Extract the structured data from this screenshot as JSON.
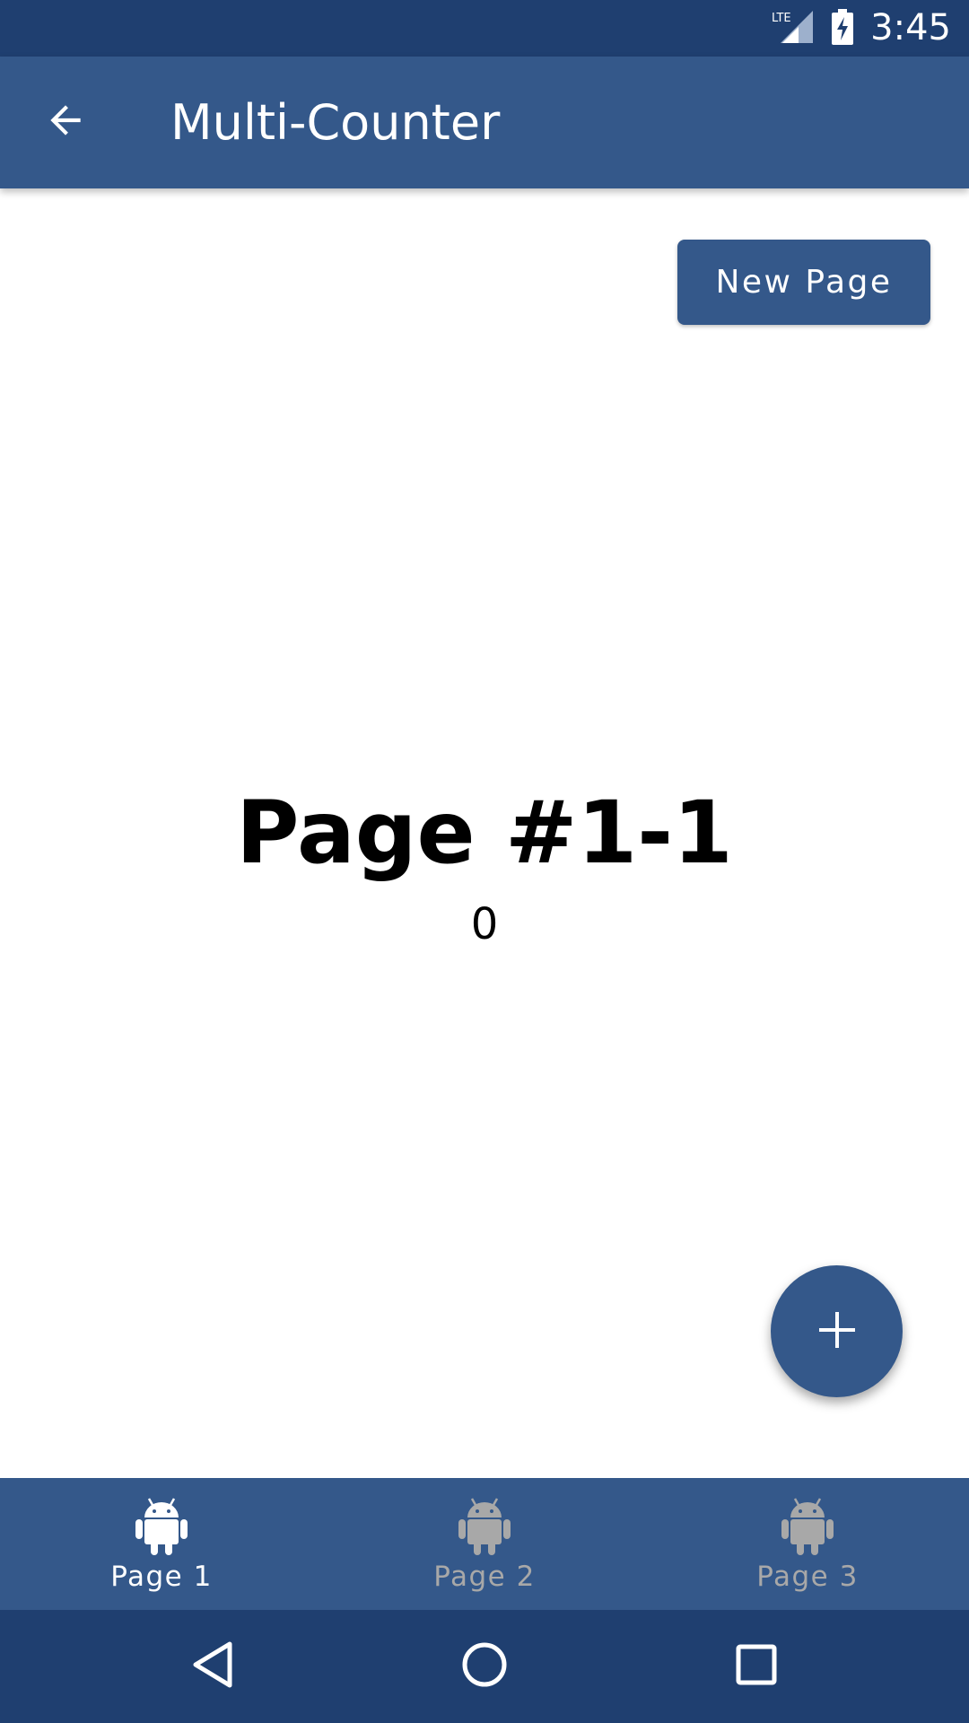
{
  "status_bar": {
    "network": "LTE",
    "time": "3:45",
    "icons": [
      "lte-signal-icon",
      "battery-charging-icon"
    ]
  },
  "app_bar": {
    "title": "Multi-Counter",
    "back_icon": "arrow-back-icon"
  },
  "main": {
    "new_page_label": "New Page",
    "page_heading": "Page #1-1",
    "counter_value": "0",
    "fab_icon": "plus-icon"
  },
  "bottom_nav": {
    "items": [
      {
        "label": "Page 1",
        "icon": "android-icon",
        "active": true
      },
      {
        "label": "Page 2",
        "icon": "android-icon",
        "active": false
      },
      {
        "label": "Page 3",
        "icon": "android-icon",
        "active": false
      }
    ]
  },
  "system_nav": {
    "icons": [
      "nav-back-icon",
      "nav-home-icon",
      "nav-recents-icon"
    ]
  },
  "colors": {
    "primary": "#34588a",
    "primary_dark": "#1f3f70",
    "active_label": "#ffffff",
    "inactive_label": "#a8a8a8"
  }
}
